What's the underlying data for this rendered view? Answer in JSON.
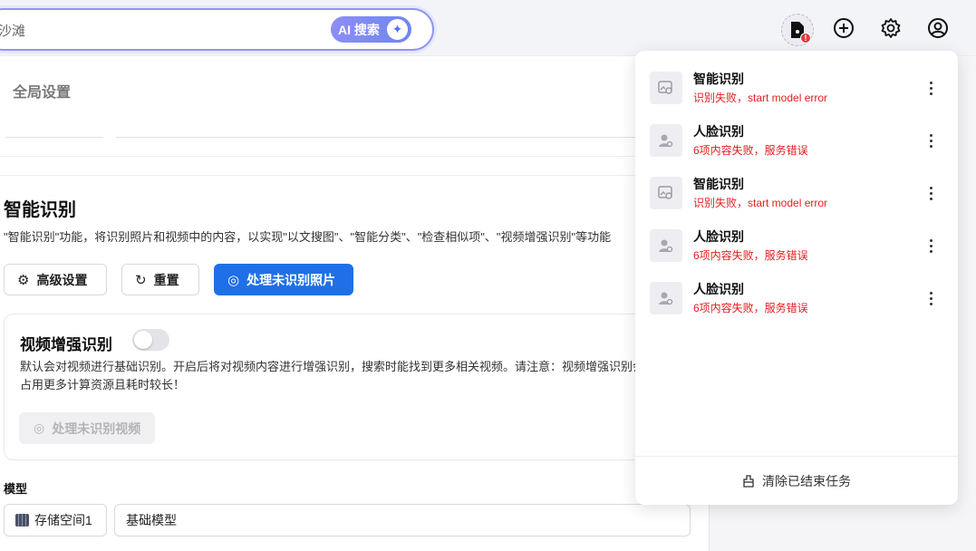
{
  "search": {
    "value": "沙滩",
    "ai_button_label": "AI 搜索"
  },
  "topbar_icons": {
    "task": "task-file-icon",
    "task_badge": "!",
    "add": "plus-circle-icon",
    "settings": "gear-icon",
    "account": "user-circle-icon"
  },
  "main": {
    "page_title": "全局设置",
    "section_title": "智能识别",
    "section_desc": "\"智能识别\"功能，将识别照片和视频中的内容，以实现\"以文搜图\"、\"智能分类\"、\"检查相似项\"、\"视频增强识别\"等功能",
    "buttons": {
      "advanced": "高级设置",
      "reset": "重置",
      "process_photos": "处理未识别照片"
    },
    "video_card": {
      "title": "视频增强识别",
      "toggle_on": false,
      "desc": "默认会对视频进行基础识别。开启后将对视频内容进行增强识别，搜索时能找到更多相关视频。请注意：视频增强识别会占用更多计算资源且耗时较长！",
      "process_button": "处理未识别视频"
    },
    "model": {
      "label": "模型",
      "storage": "存储空间1",
      "selected": "基础模型"
    }
  },
  "tasks": {
    "items": [
      {
        "title": "智能识别",
        "status": "识别失败，start model error",
        "thumb": "image-search-icon"
      },
      {
        "title": "人脸识别",
        "status": "6项内容失败，服务错误",
        "thumb": "face-search-icon"
      },
      {
        "title": "智能识别",
        "status": "识别失败，start model error",
        "thumb": "image-search-icon"
      },
      {
        "title": "人脸识别",
        "status": "6项内容失败，服务错误",
        "thumb": "face-search-icon"
      },
      {
        "title": "人脸识别",
        "status": "6项内容失败，服务错误",
        "thumb": "face-search-icon"
      }
    ],
    "clear_label": "清除已结束任务"
  },
  "colors": {
    "primary": "#1f6fe8",
    "error": "#e02020",
    "ai_gradient_start": "#8d8ef5",
    "ai_gradient_end": "#6f86f1"
  }
}
